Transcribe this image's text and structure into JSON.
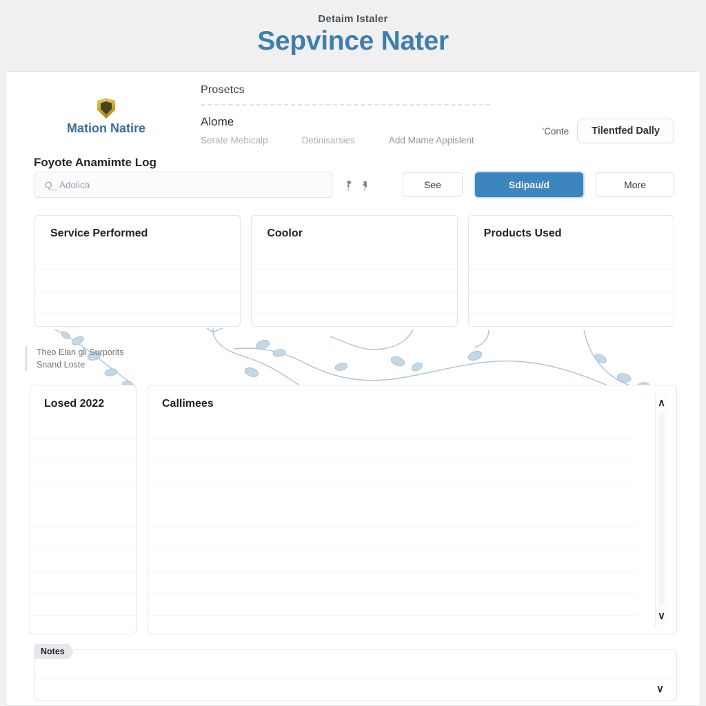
{
  "banner": {
    "kicker": "Detaim Istaler",
    "title": "Sepvince Nater",
    "title_color": "#3d7fae"
  },
  "brand": {
    "logo_icon": "gold-shield-icon",
    "name": "Mation Natire",
    "name_color": "#35709c"
  },
  "page_title": "Foyote Anamimte Log",
  "nav": {
    "section_label": "Prosetcs",
    "primary_label": "Alome",
    "links": [
      {
        "label": "Serate Mebicalp"
      },
      {
        "label": "Detinisarsies"
      },
      {
        "label": "Add Mame Appislent"
      }
    ]
  },
  "header_right": {
    "note": "'Conte",
    "button_label": "Tilentfed Dally"
  },
  "search": {
    "placeholder": "Q_ Adolica",
    "value": "",
    "icon_a": "filter-icon",
    "icon_b": "sort-icon"
  },
  "toolbar": {
    "see_label": "See",
    "primary_label": "Sdipau/d",
    "primary_color": "#3d85bd",
    "more_label": "More"
  },
  "cards": [
    {
      "title": "Service Performed"
    },
    {
      "title": "Coolor"
    },
    {
      "title": "Products Used"
    }
  ],
  "caption": {
    "line1": "Theo Elan gli Surporits",
    "line2": "Snand Loste"
  },
  "lower": {
    "left_title": "Losed 2022",
    "main_title": "Callimees",
    "scroll_up_icon": "chevron-up-icon",
    "scroll_down_icon": "chevron-down-icon"
  },
  "notes": {
    "tab_label": "Notes",
    "expand_icon": "chevron-down-icon"
  },
  "decor": {
    "vine_icon": "botanical-vine-illustration",
    "vine_color": "#a9c4d8"
  }
}
